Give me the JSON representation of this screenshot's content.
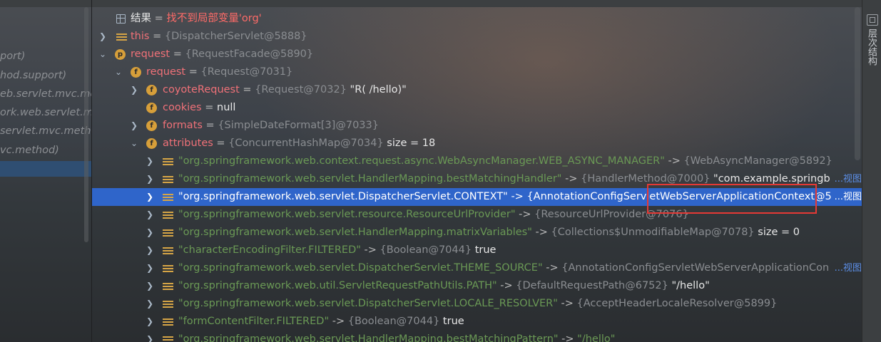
{
  "frames": {
    "items": [
      "port)",
      "hod.support)",
      "eb.servlet.mvc.me",
      "ork.web.servlet.m",
      "servlet.mvc.meth",
      "vc.method)"
    ]
  },
  "tree": {
    "rows": [
      {
        "kind": "result",
        "name": "结果",
        "eq": " = ",
        "value": "找不到局部变量'org'"
      },
      {
        "kind": "field",
        "name": "this",
        "eq": " = ",
        "type": "{DispatcherServlet@5888}"
      },
      {
        "kind": "param",
        "name": "request",
        "eq": " = ",
        "type": "{RequestFacade@5890}"
      },
      {
        "kind": "field",
        "name": "request",
        "eq": " = ",
        "type": "{Request@7031}"
      },
      {
        "kind": "field",
        "name": "coyoteRequest",
        "eq": " = ",
        "type": "{Request@7032}",
        "val": " \"R( /hello)\""
      },
      {
        "kind": "field",
        "name": "cookies",
        "eq": " = ",
        "val": "null"
      },
      {
        "kind": "field",
        "name": "formats",
        "eq": " = ",
        "type": "{SimpleDateFormat[3]@7033}"
      },
      {
        "kind": "field",
        "name": "attributes",
        "eq": " = ",
        "type": "{ConcurrentHashMap@7034}",
        "val": "  size = 18"
      },
      {
        "kind": "entry",
        "key": "\"org.springframework.web.context.request.async.WebAsyncManager.WEB_ASYNC_MANAGER\"",
        "arrow": " -> ",
        "type": "{WebAsyncManager@5892}"
      },
      {
        "kind": "entry",
        "key": "\"org.springframework.web.servlet.HandlerMapping.bestMatchingHandler\"",
        "arrow": " -> ",
        "type": "{HandlerMethod@7000}",
        "val": " \"com.example.springb",
        "view": "...视图"
      },
      {
        "kind": "entry",
        "key": "\"org.springframework.web.servlet.DispatcherServlet.CONTEXT\"",
        "arrow": " -> ",
        "type": "{AnnotationConfigServletWebServerApplicationContext@5",
        "view": "...视图",
        "selected": true
      },
      {
        "kind": "entry",
        "key": "\"org.springframework.web.servlet.resource.ResourceUrlProvider\"",
        "arrow": " -> ",
        "type": "{ResourceUrlProvider@7076}"
      },
      {
        "kind": "entry",
        "key": "\"org.springframework.web.servlet.HandlerMapping.matrixVariables\"",
        "arrow": " -> ",
        "type": "{Collections$UnmodifiableMap@7078}",
        "val": "  size = 0"
      },
      {
        "kind": "entry",
        "key": "\"characterEncodingFilter.FILTERED\"",
        "arrow": " -> ",
        "type": "{Boolean@7044}",
        "val": " true"
      },
      {
        "kind": "entry",
        "key": "\"org.springframework.web.servlet.DispatcherServlet.THEME_SOURCE\"",
        "arrow": " -> ",
        "type": "{AnnotationConfigServletWebServerApplicationCon",
        "view": "...视图"
      },
      {
        "kind": "entry",
        "key": "\"org.springframework.web.util.ServletRequestPathUtils.PATH\"",
        "arrow": " -> ",
        "type": "{DefaultRequestPath@6752}",
        "val": " \"/hello\""
      },
      {
        "kind": "entry",
        "key": "\"org.springframework.web.servlet.DispatcherServlet.LOCALE_RESOLVER\"",
        "arrow": " -> ",
        "type": "{AcceptHeaderLocaleResolver@5899}"
      },
      {
        "kind": "entry",
        "key": "\"formContentFilter.FILTERED\"",
        "arrow": " -> ",
        "type": "{Boolean@7044}",
        "val": " true"
      },
      {
        "kind": "entry",
        "key": "\"org.springframework.web.servlet.HandlerMapping.bestMatchingPattern\"",
        "arrow": " -> ",
        "val": "\"/hello\""
      }
    ]
  },
  "sidebar_right": {
    "label": "层次结构"
  },
  "colors": {
    "selection": "#2f65ca",
    "highlight_box": "#e53935",
    "field_name": "#f07178",
    "string": "#6a9955"
  }
}
